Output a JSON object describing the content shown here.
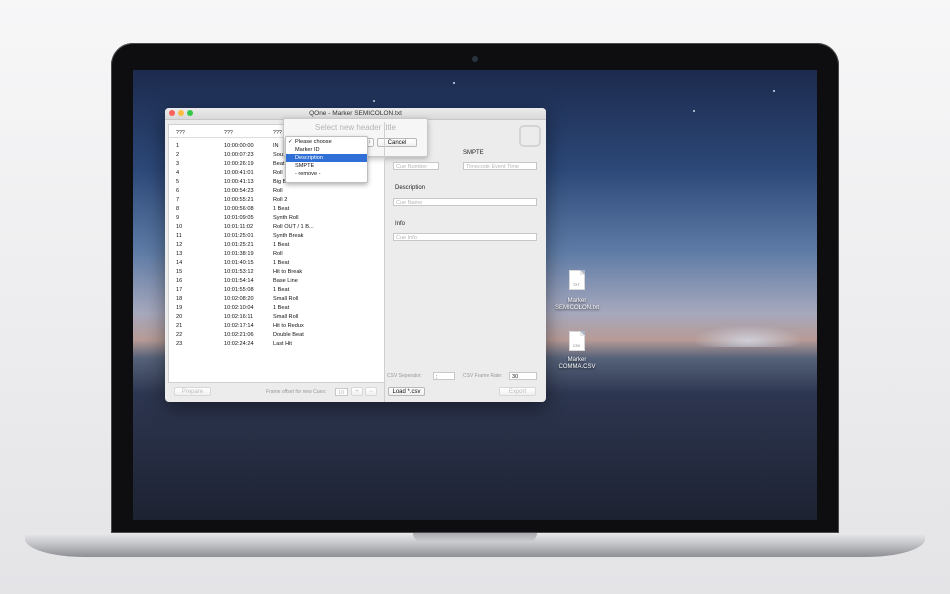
{
  "window": {
    "title": "QOne - Marker SEMICOLON.txt"
  },
  "table": {
    "headers": [
      "???",
      "???",
      "???"
    ],
    "rows": [
      [
        "1",
        "10:00:00:00",
        "IN"
      ],
      [
        "2",
        "10:00:07:23",
        "Sou"
      ],
      [
        "3",
        "10:00:26:19",
        "Beat"
      ],
      [
        "4",
        "10:00:41:01",
        "Roll"
      ],
      [
        "5",
        "10:00:41:13",
        "Big Beat"
      ],
      [
        "6",
        "10:00:54:23",
        "Roll"
      ],
      [
        "7",
        "10:00:55:21",
        "Roll 2"
      ],
      [
        "8",
        "10:00:56:08",
        "1 Beat"
      ],
      [
        "9",
        "10:01:09:05",
        "Synth Roll"
      ],
      [
        "10",
        "10:01:11:02",
        "Roll OUT / 1 B..."
      ],
      [
        "11",
        "10:01:25:01",
        "Synth Break"
      ],
      [
        "12",
        "10:01:25:21",
        "1 Beat"
      ],
      [
        "13",
        "10:01:38:19",
        "Roll"
      ],
      [
        "14",
        "10:01:40:15",
        "1 Beat"
      ],
      [
        "15",
        "10:01:53:12",
        "Hit to Break"
      ],
      [
        "16",
        "10:01:54:14",
        "Base Line"
      ],
      [
        "17",
        "10:01:55:08",
        "1 Beat"
      ],
      [
        "18",
        "10:02:08:20",
        "Small Roll"
      ],
      [
        "19",
        "10:02:10:04",
        "1 Beat"
      ],
      [
        "20",
        "10:02:16:11",
        "Small Roll"
      ],
      [
        "21",
        "10:02:17:14",
        "Hit to Redux"
      ],
      [
        "22",
        "10:02:21:06",
        "Double Beat"
      ],
      [
        "23",
        "10:02:24:24",
        "Last Hit"
      ]
    ]
  },
  "popover": {
    "title": "Select new header title",
    "cancel_label": "Cancel",
    "menu_items": [
      {
        "label": "Please choose",
        "checked": true
      },
      {
        "label": "Marker ID"
      },
      {
        "label": "Description",
        "selected": true
      },
      {
        "label": "SMPTE"
      },
      {
        "label": "- remove -"
      }
    ],
    "checkmark": "✓"
  },
  "form": {
    "cue_number_placeholder": "Cue Number",
    "smpte_label": "SMPTE",
    "smpte_placeholder": "Timecode Event Time",
    "description_label": "Description",
    "description_placeholder": "Cue Name",
    "info_label": "Info",
    "info_placeholder": "Cue Info",
    "csv_separator_label": "CSV Seperator:",
    "csv_separator_value": ";",
    "csv_frame_rate_label": "CSV Frame Rate:",
    "csv_frame_rate_value": "30"
  },
  "bottom_bar": {
    "prepare_label": "Prepare",
    "frame_offset_label": "Frame offset for new Cues:",
    "frame_offset_value": "10",
    "plus_label": "+",
    "minus_label": "−",
    "load_label": "Load *.csv",
    "export_label": "Export"
  },
  "desktop_icons": [
    {
      "label_line1": "Marker",
      "label_line2": "SEMICOLON.txt",
      "badge": "TXT"
    },
    {
      "label_line1": "Marker",
      "label_line2": "COMMA.CSV",
      "badge": "CSV"
    }
  ],
  "colors": {
    "accent": "#2f6fd6",
    "close": "#fc605c",
    "minimize": "#fdbc40",
    "zoom": "#34c84a"
  }
}
